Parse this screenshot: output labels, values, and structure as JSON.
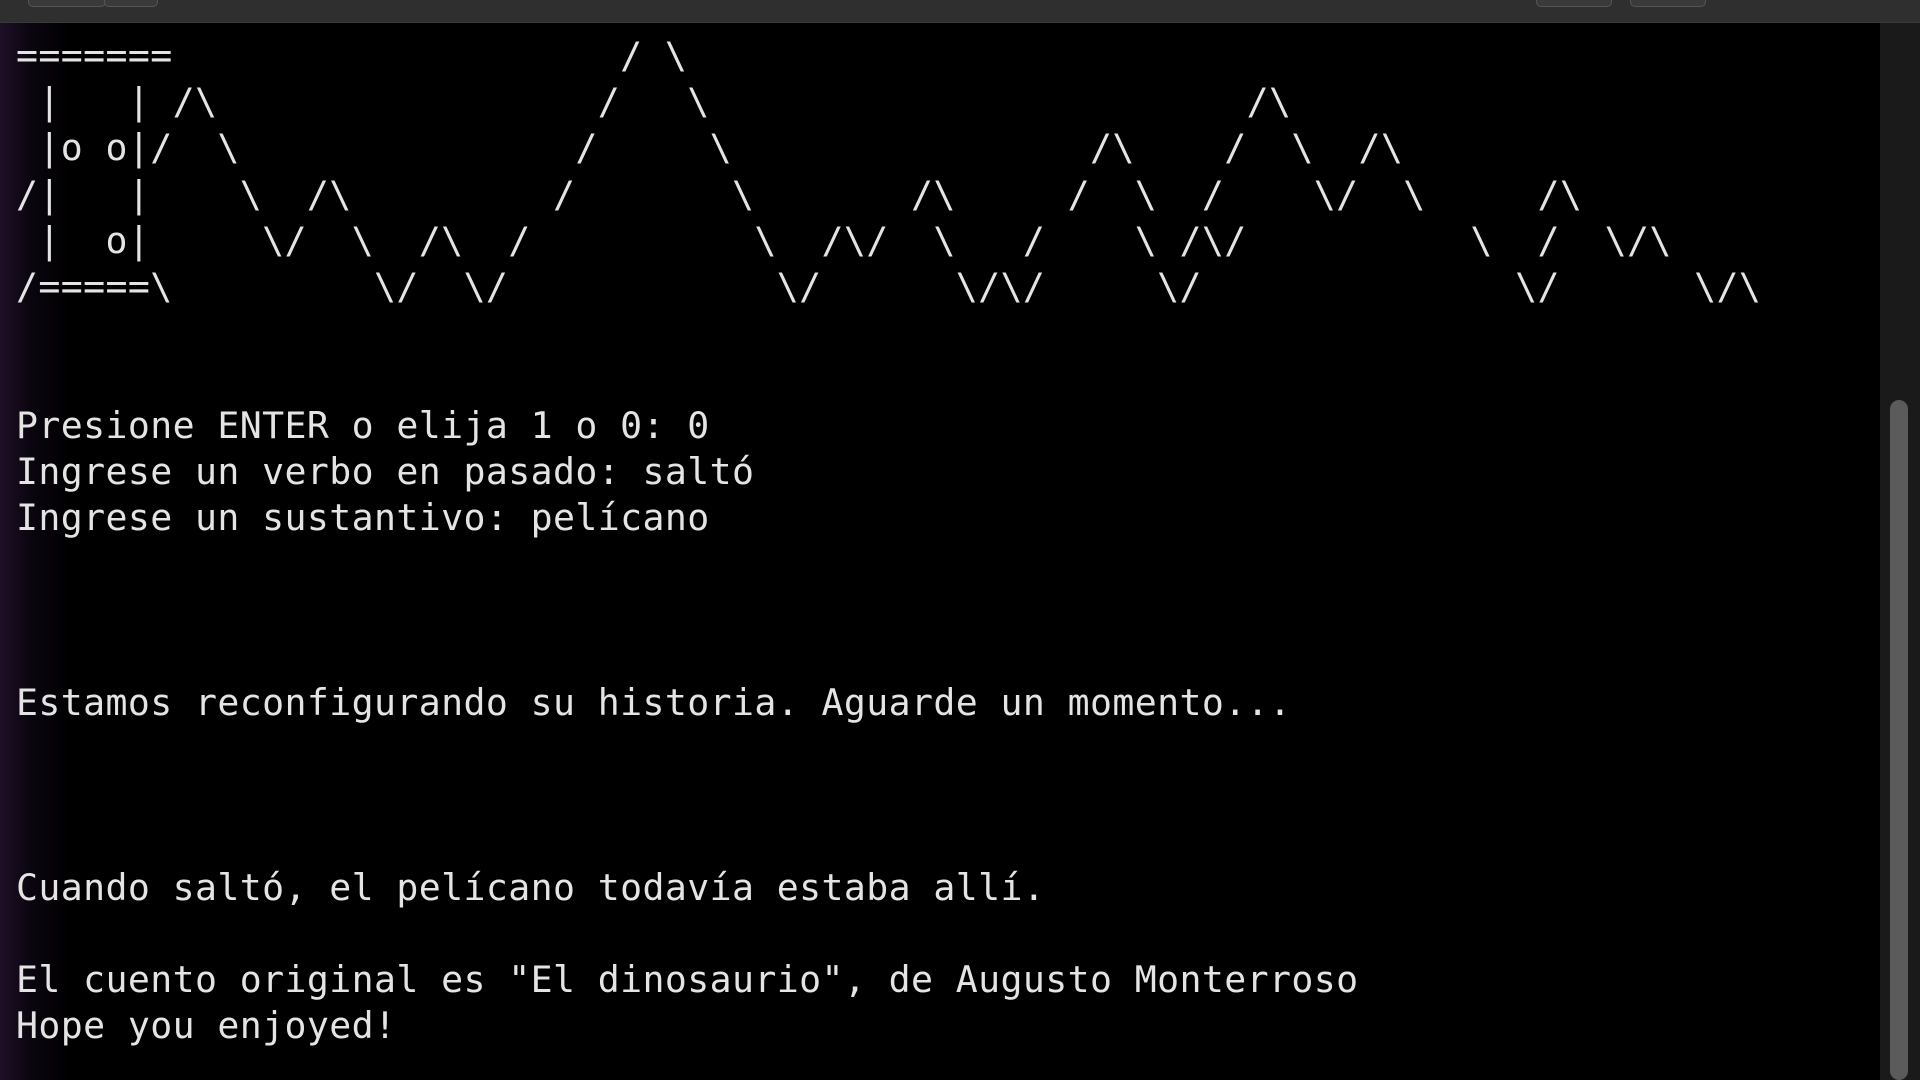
{
  "terminal": {
    "ascii_art": "=======                    / \\\n |   | /\\                 /   \\                        /\\\n |o o|/  \\               /     \\                /\\    /  \\  /\\\n/|   |    \\  /\\         /       \\       /\\     /  \\  /    \\/  \\     /\\\n |  o|     \\/  \\  /\\  /          \\  /\\/  \\   /    \\ /\\/          \\  /  \\/\\\n/=====\\         \\/  \\/            \\/      \\/\\/     \\/              \\/      \\/\\",
    "lines": [
      "Presione ENTER o elija 1 o 0: 0",
      "Ingrese un verbo en pasado: saltó",
      "Ingrese un sustantivo: pelícano",
      "Estamos reconfigurando su historia. Aguarde un momento...",
      "Cuando saltó, el pelícano todavía estaba allí.",
      "El cuento original es \"El dinosaurio\", de Augusto Monterroso",
      "Hope you enjoyed!"
    ]
  }
}
